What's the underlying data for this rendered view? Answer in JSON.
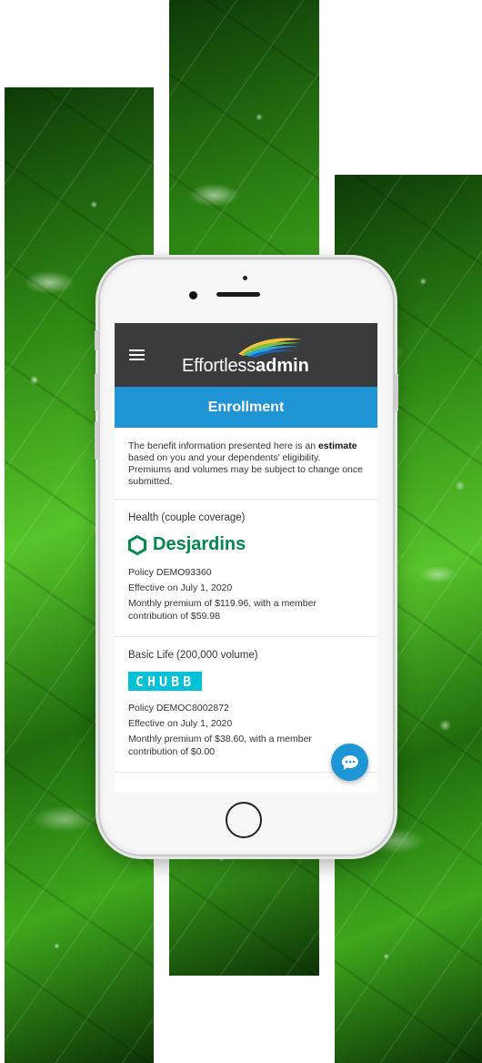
{
  "app": {
    "logo_text_light": "Effortless",
    "logo_text_bold": "admin",
    "page_title": "Enrollment",
    "menu_icon": "hamburger-menu-icon",
    "chat_icon": "chat-bubble-icon",
    "accent_color": "#2095d6",
    "header_color": "#3a3b3d"
  },
  "notice": {
    "prefix": "The benefit information presented here is an ",
    "emphasis": "estimate",
    "suffix": " based on you and your dependents' eligibility. Premiums and volumes may be subject to change once submitted."
  },
  "plans": [
    {
      "title": "Health (couple coverage)",
      "insurer": "Desjardins",
      "insurer_color": "#00874e",
      "policy": "Policy DEMO93360",
      "effective": "Effective on July 1, 2020",
      "premium": "Monthly premium of $119.96, with a member contribution of $59.98"
    },
    {
      "title": "Basic Life (200,000 volume)",
      "insurer": "CHUBB",
      "insurer_color": "#01c1d6",
      "policy": "Policy DEMOC8002872",
      "effective": "Effective on July 1, 2020",
      "premium": "Monthly premium of $38.60, with a member contribution of $0.00"
    }
  ]
}
